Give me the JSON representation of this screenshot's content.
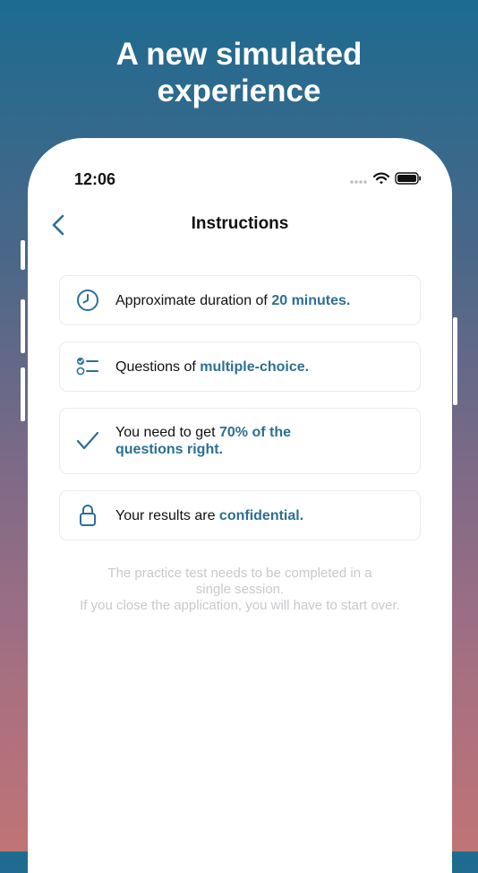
{
  "promo": {
    "headline_line1": "A new simulated",
    "headline_line2": "experience"
  },
  "status_bar": {
    "time": "12:06"
  },
  "nav": {
    "title": "Instructions"
  },
  "items": [
    {
      "icon": "clock-icon",
      "text": "Approximate duration of ",
      "highlight": "20 minutes."
    },
    {
      "icon": "checklist-icon",
      "text": "Questions of ",
      "highlight": "multiple-choice."
    },
    {
      "icon": "checkmark-icon",
      "text": "You need to get ",
      "highlight": "70% of the questions right."
    },
    {
      "icon": "lock-icon",
      "text": "Your results are ",
      "highlight": "confidential."
    }
  ],
  "footnote": {
    "line1": "The practice test needs to be completed in a",
    "line2": "single session.",
    "line3": "If you close the application, you will have to start over."
  },
  "colors": {
    "accent": "#2d6f93",
    "footnote": "#c8c9cd",
    "gradient_top": "#1d6b90",
    "gradient_bottom": "#c07476"
  }
}
